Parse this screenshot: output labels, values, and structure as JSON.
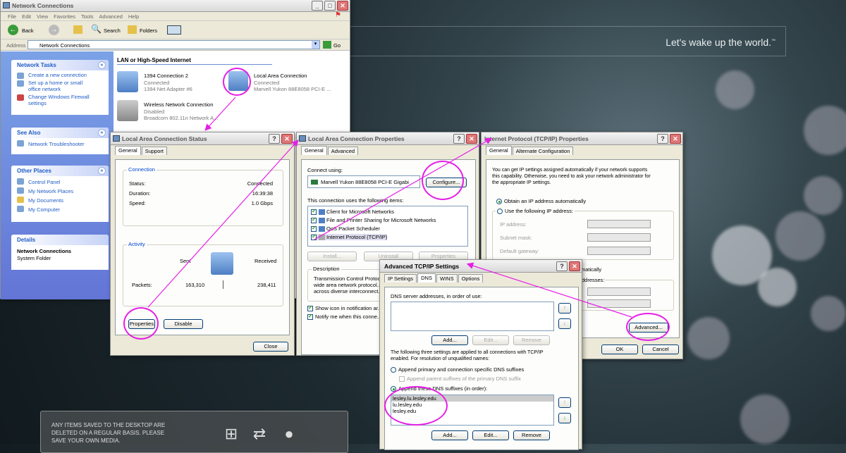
{
  "desktop": {
    "tagline": "Let's wake up the world.",
    "tagline_tm": "™",
    "notice": "ANY ITEMS SAVED TO THE DESKTOP ARE\nDELETED ON A REGULAR BASIS. PLEASE\nSAVE YOUR OWN MEDIA."
  },
  "explorer": {
    "title": "Network Connections",
    "menu": [
      "File",
      "Edit",
      "View",
      "Favorites",
      "Tools",
      "Advanced",
      "Help"
    ],
    "toolbar": {
      "back": "Back",
      "search": "Search",
      "folders": "Folders"
    },
    "address_label": "Address",
    "address": "Network Connections",
    "go": "Go",
    "section": "LAN or High-Speed Internet",
    "network_tasks": {
      "title": "Network Tasks",
      "items": [
        "Create a new connection",
        "Set up a home or small office network",
        "Change Windows Firewall settings"
      ]
    },
    "see_also": {
      "title": "See Also",
      "items": [
        "Network Troubleshooter"
      ]
    },
    "other_places": {
      "title": "Other Places",
      "items": [
        "Control Panel",
        "My Network Places",
        "My Documents",
        "My Computer"
      ]
    },
    "details": {
      "title": "Details",
      "name": "Network Connections",
      "type": "System Folder"
    },
    "connections": [
      {
        "name": "1394 Connection 2",
        "status": "Connected",
        "device": "1394 Net Adapter #6"
      },
      {
        "name": "Local Area Connection",
        "status": "Connected",
        "device": "Marvell Yukon 88E8058 PCI-E ..."
      },
      {
        "name": "Wireless Network Connection",
        "status": "Disabled",
        "device": "Broadcom 802.11n Network A..."
      }
    ]
  },
  "status_dialog": {
    "title": "Local Area Connection Status",
    "tabs": [
      "General",
      "Support"
    ],
    "connection_label": "Connection",
    "status_label": "Status:",
    "status": "Connected",
    "duration_label": "Duration:",
    "duration": "16:39:38",
    "speed_label": "Speed:",
    "speed": "1.0 Gbps",
    "activity_label": "Activity",
    "sent_label": "Sent",
    "received_label": "Received",
    "packets_label": "Packets:",
    "sent": "163,310",
    "received": "238,411",
    "properties": "Properties",
    "disable": "Disable",
    "close": "Close"
  },
  "props_dialog": {
    "title": "Local Area Connection Properties",
    "tabs": [
      "General",
      "Advanced"
    ],
    "connect_using": "Connect using:",
    "adapter": "Marvell Yukon 88E8058 PCI-E Gigabi",
    "configure": "Configure...",
    "items_label": "This connection uses the following items:",
    "items": [
      "Client for Microsoft Networks",
      "File and Printer Sharing for Microsoft Networks",
      "QoS Packet Scheduler",
      "Internet Protocol (TCP/IP)"
    ],
    "install": "Install...",
    "uninstall": "Uninstall",
    "properties": "Properties",
    "description_label": "Description",
    "description": "Transmission Control Protoc...\nwide area network protocol...\nacross diverse interconnect...",
    "show_icon": "Show icon in notification ar...",
    "notify": "Notify me when this conne..."
  },
  "tcpip_dialog": {
    "title": "Internet Protocol (TCP/IP) Properties",
    "tabs": [
      "General",
      "Alternate Configuration"
    ],
    "intro": "You can get IP settings assigned automatically if your network supports\nthis capability. Otherwise, you need to ask your network administrator for\nthe appropriate IP settings.",
    "obtain_auto": "Obtain an IP address automatically",
    "use_following": "Use the following IP address:",
    "ip_label": "IP address:",
    "subnet_label": "Subnet mask:",
    "gateway_label": "Default gateway:",
    "dns_auto_fragment": "matically",
    "dns_addr_fragment": "ddresses:",
    "advanced": "Advanced...",
    "ok": "OK",
    "cancel": "Cancel"
  },
  "advanced_dialog": {
    "title": "Advanced TCP/IP Settings",
    "tabs": [
      "IP Settings",
      "DNS",
      "WINS",
      "Options"
    ],
    "dns_servers_label": "DNS server addresses, in order of use:",
    "add": "Add...",
    "edit": "Edit...",
    "remove": "Remove",
    "settings_note": "The following three settings are applied to all connections with TCP/IP\nenabled. For resolution of unqualified names:",
    "append_primary": "Append primary and connection specific DNS suffixes",
    "append_parent": "Append parent suffixes of the primary DNS suffix",
    "append_these": "Append these DNS suffixes (in order):",
    "suffixes": [
      "lesley.lu.lesley.edu",
      "lu.lesley.edu",
      "lesley.edu"
    ]
  },
  "colors": {
    "highlight": "#e61ee6",
    "xp_blue": "#215dc6"
  }
}
